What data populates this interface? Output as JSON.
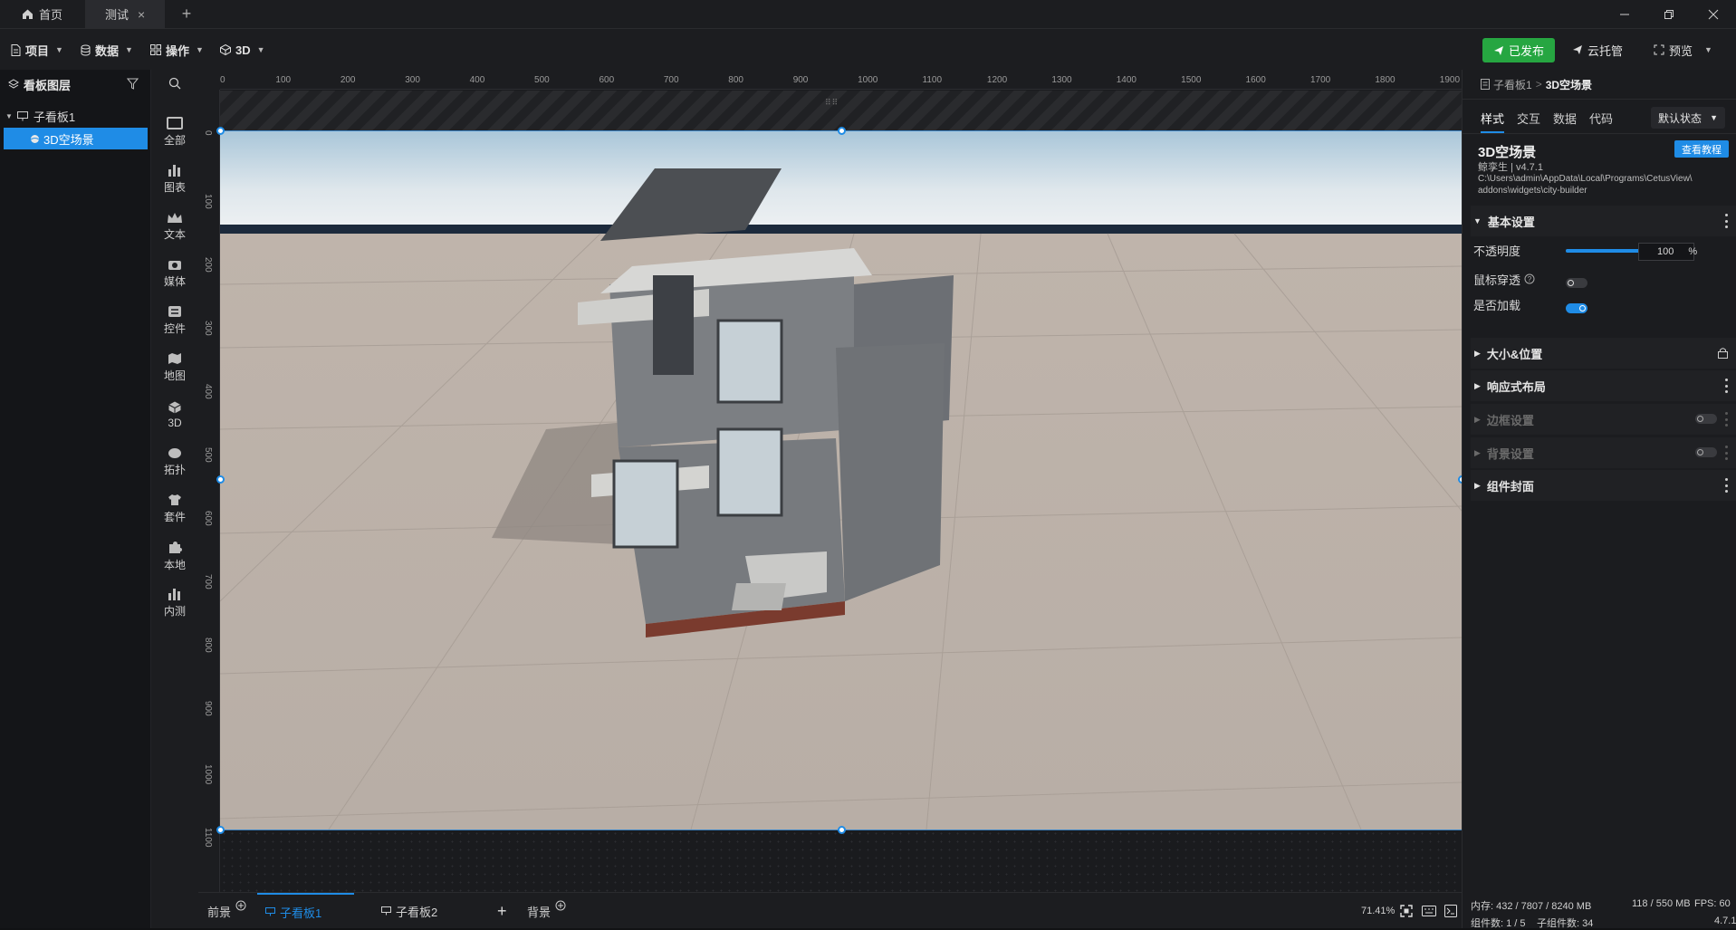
{
  "titlebar": {
    "tabs": [
      {
        "label": "首页",
        "active": false
      },
      {
        "label": "测试",
        "active": true
      }
    ],
    "new_tab": "+",
    "close_glyph": "×"
  },
  "menubar": {
    "items": [
      {
        "label": "项目",
        "icon": "file-icon"
      },
      {
        "label": "数据",
        "icon": "database-icon"
      },
      {
        "label": "操作",
        "icon": "grid-icon"
      },
      {
        "label": "3D",
        "icon": "cube-icon"
      }
    ],
    "publish": "已发布",
    "cloud": "云托管",
    "preview": "预览",
    "colors": {
      "publish": "#26a641",
      "accent": "#1f8ce6"
    }
  },
  "layers": {
    "title": "看板图层",
    "tree": [
      {
        "label": "子看板1",
        "level": 0,
        "selected": false
      },
      {
        "label": "3D空场景",
        "level": 1,
        "selected": true
      }
    ]
  },
  "components": {
    "items": [
      "全部",
      "图表",
      "文本",
      "媒体",
      "控件",
      "地图",
      "3D",
      "拓扑",
      "套件",
      "本地",
      "内测"
    ]
  },
  "ruler": {
    "top": [
      "0",
      "100",
      "200",
      "300",
      "400",
      "500",
      "600",
      "700",
      "800",
      "900",
      "1000",
      "1100",
      "1200",
      "1300",
      "1400",
      "1500",
      "1600",
      "1700",
      "1800",
      "1900"
    ],
    "left": [
      "0",
      "100",
      "200",
      "300",
      "400",
      "500",
      "600",
      "700",
      "800",
      "900",
      "1000",
      "1100"
    ]
  },
  "bottombar": {
    "tabs": [
      {
        "label": "前景",
        "active": false
      },
      {
        "label": "子看板1",
        "active": true
      },
      {
        "label": "子看板2",
        "active": false
      },
      {
        "label": "背景",
        "active": false
      }
    ],
    "zoom": "71.41%"
  },
  "panel": {
    "breadcrumb_parent": "子看板1",
    "breadcrumb_sep": ">",
    "breadcrumb_current": "3D空场景",
    "tabs": [
      "样式",
      "交互",
      "数据",
      "代码"
    ],
    "state_select": "默认状态",
    "widget_title": "3D空场景",
    "tutorial": "查看教程",
    "meta": "鲸孪生 | v4.7.1",
    "path_line1": "C:\\Users\\admin\\AppData\\Local\\Programs\\CetusView\\",
    "path_line2": "addons\\widgets\\city-builder",
    "sections": [
      {
        "label": "基本设置",
        "expanded": true,
        "disabled": false
      },
      {
        "label": "大小&位置",
        "expanded": false,
        "disabled": false
      },
      {
        "label": "响应式布局",
        "expanded": false,
        "disabled": false
      },
      {
        "label": "边框设置",
        "expanded": false,
        "disabled": true
      },
      {
        "label": "背景设置",
        "expanded": false,
        "disabled": true
      },
      {
        "label": "组件封面",
        "expanded": false,
        "disabled": false
      }
    ],
    "opacity_label": "不透明度",
    "opacity_value": "100",
    "opacity_unit": "%",
    "opacity_fraction": 1.0,
    "mouse_through_label": "鼠标穿透",
    "mouse_through_on": false,
    "load_label": "是否加载",
    "load_on": true
  },
  "status": {
    "memory": "内存: 432 / 7807 / 8240 MB",
    "memory2": "118 / 550 MB",
    "fps": "FPS: 60",
    "components": "组件数: 1 / 5",
    "sub_components": "子组件数: 34",
    "version": "4.7.1"
  }
}
